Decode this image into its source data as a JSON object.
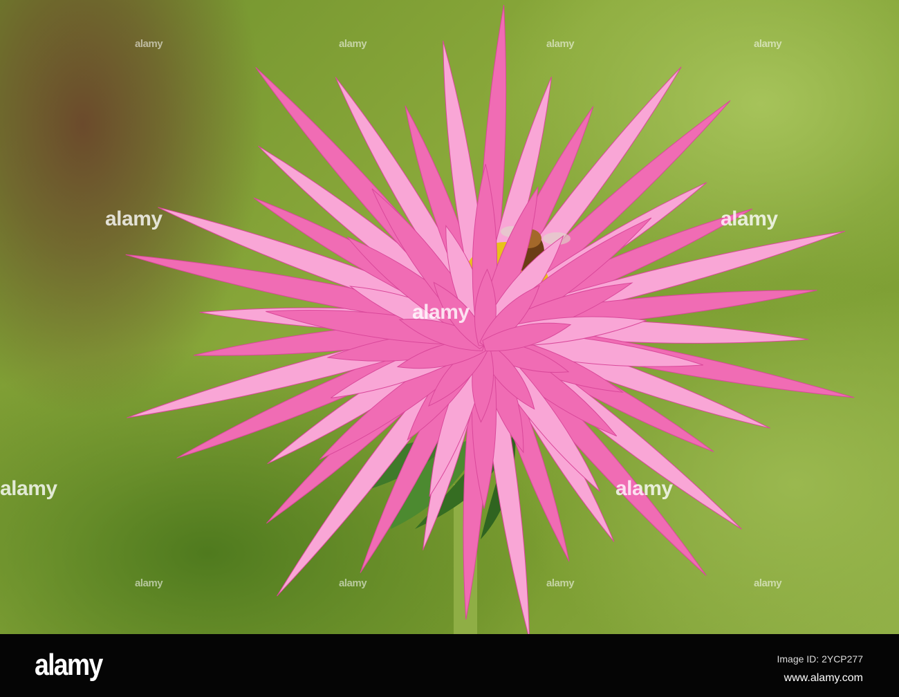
{
  "photo": {
    "subject": "pink cactus dahlia with bee",
    "colors": {
      "petal": "#f06cb4",
      "petal_light": "#f9a6d6",
      "petal_dark": "#d9489a",
      "center": "#e8c21a",
      "leaf": "#3f7a2a",
      "stem": "#8fae45"
    }
  },
  "watermark": {
    "text": "alamy"
  },
  "footer": {
    "logo": "alamy",
    "image_id": "Image ID: 2YCP277",
    "site": "www.alamy.com"
  }
}
